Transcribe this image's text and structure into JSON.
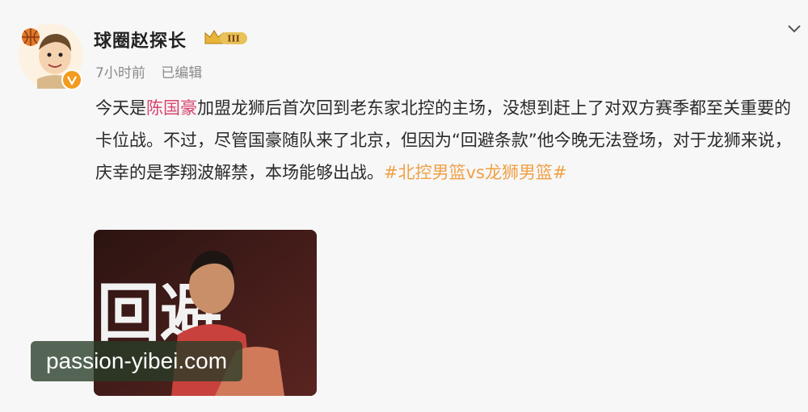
{
  "post": {
    "username": "球圈赵探长",
    "level_badge": "III",
    "time": "7小时前",
    "edited": "已编辑",
    "text_before": "今天是",
    "mention": "陈国豪",
    "text_middle": "加盟龙狮后首次回到老东家北控的主场，没想到赶上了对双方赛季都至关重要的卡位战。不过，尽管国豪随队来了北京，但因为“回避条款”他今晚无法登场，对于龙狮来说，庆幸的是李翔波解禁，本场能够出战。",
    "hashtag": "#北控男篮vs龙狮男篮#",
    "image_text": "回避",
    "watermark": "passion-yibei.com"
  },
  "icons": {
    "avatar": "cartoon-avatar-with-basketball",
    "verified": "verified-v-icon",
    "crown": "crown-level-icon",
    "menu": "chevron-down-icon"
  },
  "colors": {
    "mention": "#d8446e",
    "hashtag": "#f0a046",
    "verified": "#f29b1f"
  }
}
